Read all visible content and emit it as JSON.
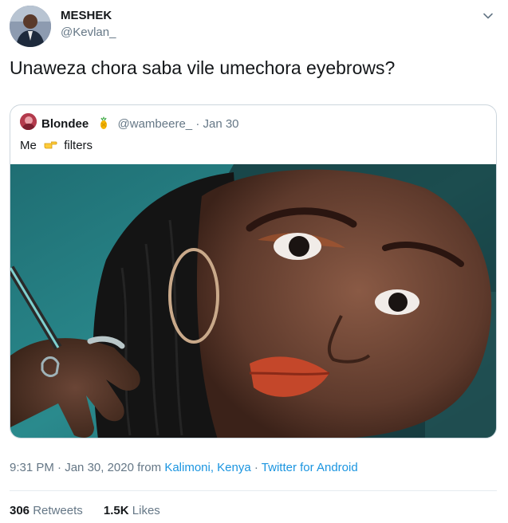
{
  "author": {
    "name": "MESHEK",
    "handle": "@Kevlan_"
  },
  "tweet_text": "Unaweza chora saba vile umechora eyebrows?",
  "quote": {
    "name": "Blondee",
    "name_emoji": "pineapple-emoji",
    "handle": "@wambeere_",
    "separator": "·",
    "date": "Jan 30",
    "text_before": "Me",
    "text_emoji": "pointing-right-hand-emoji",
    "text_after": "filters"
  },
  "meta": {
    "time": "9:31 PM",
    "sep1": "·",
    "date": "Jan 30, 2020",
    "from_word": "from",
    "location": "Kalimoni, Kenya",
    "sep2": "·",
    "source": "Twitter for Android"
  },
  "stats": {
    "retweets_count": "306",
    "retweets_label": "Retweets",
    "likes_count": "1.5K",
    "likes_label": "Likes"
  },
  "colors": {
    "link": "#1b95e0",
    "secondary_text": "#657786",
    "border": "#ccd6dd"
  }
}
